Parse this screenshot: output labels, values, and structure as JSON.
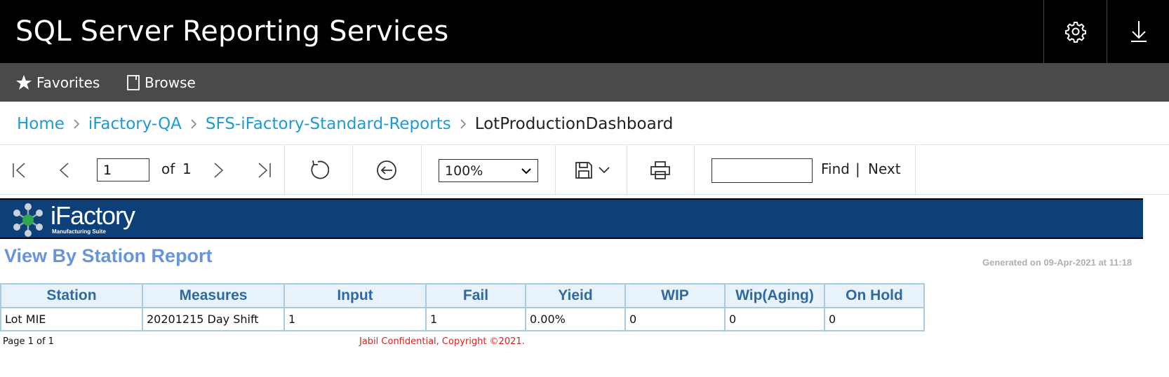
{
  "header": {
    "app_title": "SQL Server Reporting Services",
    "settings_icon": "gear-icon",
    "download_icon": "download-icon"
  },
  "nav": {
    "favorites": "Favorites",
    "browse": "Browse"
  },
  "breadcrumb": {
    "items": [
      "Home",
      "iFactory-QA",
      "SFS-iFactory-Standard-Reports"
    ],
    "current": "LotProductionDashboard"
  },
  "toolbar": {
    "page_value": "1",
    "of_label": "of",
    "total_pages": "1",
    "zoom": "100%",
    "find_value": "",
    "find_label": "Find",
    "separator": "|",
    "next_label": "Next"
  },
  "report": {
    "logo_name": "iFactory",
    "logo_tagline": "Manufacturing Suite",
    "title": "View By Station Report",
    "generated": "Generated on 09-Apr-2021 at 11:18",
    "columns": [
      "Station",
      "Measures",
      "Input",
      "Fail",
      "Yieid",
      "WIP",
      "Wip(Aging)",
      "On Hold"
    ],
    "rows": [
      [
        "Lot MIE",
        "20201215 Day Shift",
        "1",
        "1",
        "0.00%",
        "0",
        "0",
        "0"
      ]
    ],
    "page_footer": "Page 1 of 1",
    "copyright": "Jabil Confidential, Copyright ©2021."
  },
  "colors": {
    "header_bg": "#000000",
    "nav_bg": "#4a4a4a",
    "link": "#1e9ad6",
    "banner": "#0d3f78",
    "title": "#6894dc",
    "table_header_bg": "#e8f2fb",
    "table_header_text": "#2e6aa1",
    "copyright": "#e02020"
  }
}
